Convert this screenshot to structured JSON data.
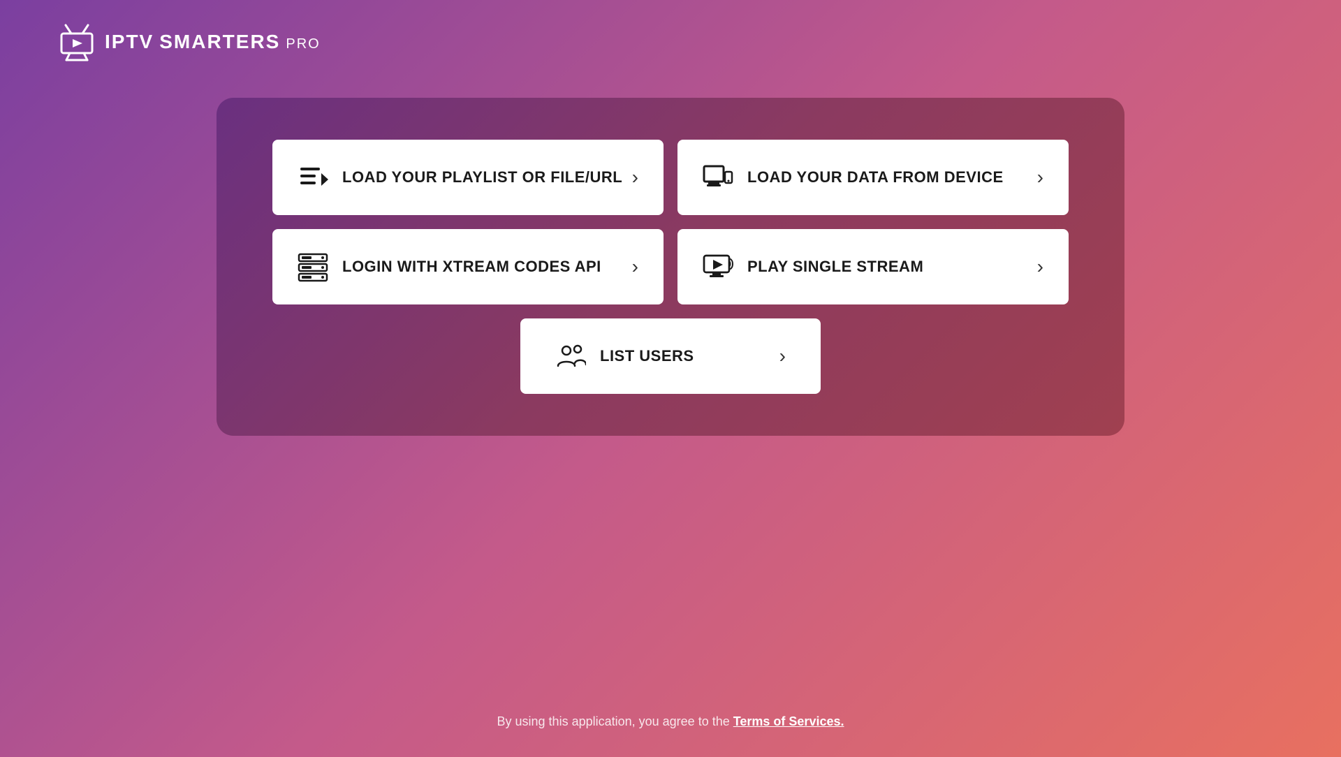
{
  "app": {
    "logo_iptv": "IPTV",
    "logo_smarters": "SMARTERS",
    "logo_pro": "PRO"
  },
  "buttons": [
    {
      "id": "load-playlist",
      "label": "LOAD YOUR PLAYLIST OR FILE/URL",
      "icon": "playlist"
    },
    {
      "id": "load-device",
      "label": "LOAD YOUR DATA FROM DEVICE",
      "icon": "device"
    },
    {
      "id": "xtream-api",
      "label": "LOGIN WITH XTREAM CODES API",
      "icon": "xtream"
    },
    {
      "id": "single-stream",
      "label": "PLAY SINGLE STREAM",
      "icon": "stream"
    }
  ],
  "center_button": {
    "id": "list-users",
    "label": "LIST USERS",
    "icon": "users"
  },
  "footer": {
    "text_before_link": "By using this application, you agree to the ",
    "link_text": "Terms of Services.",
    "text_after_link": ""
  },
  "colors": {
    "background_start": "#7b3fa0",
    "background_mid": "#c45a8a",
    "background_end": "#e87060",
    "card_bg": "#6a3080",
    "button_bg": "#ffffff",
    "button_text": "#1a1a1a"
  }
}
